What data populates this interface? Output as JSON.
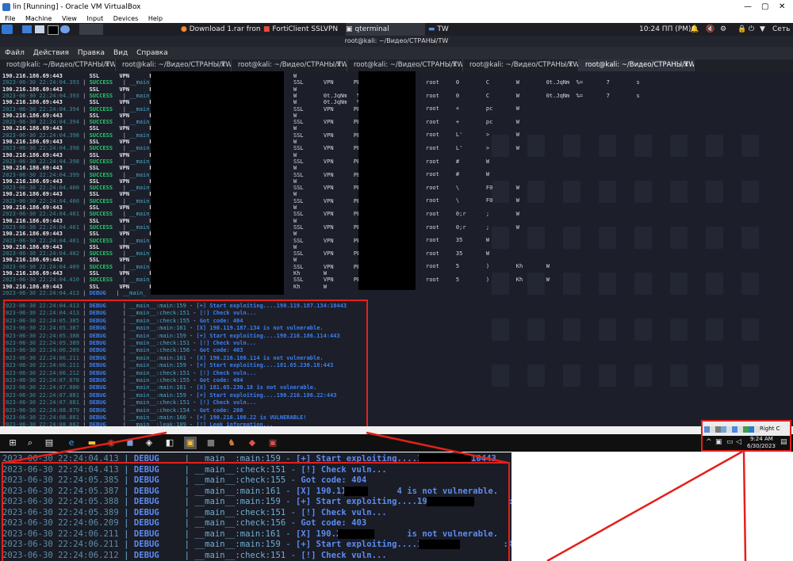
{
  "vbox": {
    "title": "lin [Running] - Oracle VM VirtualBox",
    "menu": [
      "File",
      "Machine",
      "View",
      "Input",
      "Devices",
      "Help"
    ]
  },
  "kali_panel": {
    "tasks": [
      "Download 1.rar from Se...",
      "FortiClient SSLVPN",
      "qterminal",
      "TW"
    ],
    "clock": "10:24 ПП (PM)",
    "network": "Сеть"
  },
  "terminal": {
    "title": "root@kali: ~/Видео/СТРАНЫ/TW",
    "menu": [
      "Файл",
      "Действия",
      "Правка",
      "Вид",
      "Справка"
    ],
    "tabs": [
      "root@kali: ~/Видео/СТРАНЫ/TW",
      "root@kali: ~/Видео/СТРАНЫ/TW",
      "root@kali: ~/Видео/СТРАНЫ/TW",
      "root@kali: ~/Видео/СТРАНЫ/TW",
      "root@kali: ~/Видео/СТРАНЫ/TW",
      "root@kali: ~/Видео/СТРАНЫ/TW"
    ],
    "tab_close": "×"
  },
  "left_log": [
    {
      "type": "ip",
      "text": "190.216.186.69:443        SSL      VPN      PE"
    },
    {
      "type": "succ",
      "date": "2023-06-30 22:24:04.393",
      "tag": "SUCCESS",
      "mod": "__main_"
    },
    {
      "type": "ip",
      "text": "190.216.186.69:443        SSL      VPN      PE"
    },
    {
      "type": "succ",
      "date": "2023-06-30 22:24:04.393",
      "tag": "SUCCESS",
      "mod": "__main_"
    },
    {
      "type": "ip",
      "text": "190.216.186.69:443        SSL      VPN      PE"
    },
    {
      "type": "succ",
      "date": "2023-06-30 22:24:04.394",
      "tag": "SUCCESS",
      "mod": "__main_"
    },
    {
      "type": "ip",
      "text": "190.216.186.69:443        SSL      VPN      PE"
    },
    {
      "type": "succ",
      "date": "2023-06-30 22:24:04.394",
      "tag": "SUCCESS",
      "mod": "__main_"
    },
    {
      "type": "ip",
      "text": "190.216.186.69:443        SSL      VPN      PE"
    },
    {
      "type": "succ",
      "date": "2023-06-30 22:24:04.398",
      "tag": "SUCCESS",
      "mod": "__main_"
    },
    {
      "type": "ip",
      "text": "190.216.186.69:443        SSL      VPN      PE"
    },
    {
      "type": "succ",
      "date": "2023-06-30 22:24:04.398",
      "tag": "SUCCESS",
      "mod": "__main_"
    },
    {
      "type": "ip",
      "text": "190.216.186.69:443        SSL      VPN      PE"
    },
    {
      "type": "succ",
      "date": "2023-06-30 22:24:04.398",
      "tag": "SUCCESS",
      "mod": "__main_"
    },
    {
      "type": "ip",
      "text": "190.216.186.69:443        SSL      VPN      PE"
    },
    {
      "type": "succ",
      "date": "2023-06-30 22:24:04.399",
      "tag": "SUCCESS",
      "mod": "__main_"
    },
    {
      "type": "ip",
      "text": "190.216.186.69:443        SSL      VPN      PE"
    },
    {
      "type": "succ",
      "date": "2023-06-30 22:24:04.400",
      "tag": "SUCCESS",
      "mod": "__main_"
    },
    {
      "type": "ip",
      "text": "190.216.186.69:443        SSL      VPN      PE"
    },
    {
      "type": "succ",
      "date": "2023-06-30 22:24:04.400",
      "tag": "SUCCESS",
      "mod": "__main_"
    },
    {
      "type": "ip",
      "text": "190.216.186.69:443        SSL      VPN      PE"
    },
    {
      "type": "succ",
      "date": "2023-06-30 22:24:04.401",
      "tag": "SUCCESS",
      "mod": "__main_"
    },
    {
      "type": "ip",
      "text": "190.216.186.69:443        SSL      VPN      PE"
    },
    {
      "type": "succ",
      "date": "2023-06-30 22:24:04.401",
      "tag": "SUCCESS",
      "mod": "__main_"
    },
    {
      "type": "ip",
      "text": "190.216.186.69:443        SSL      VPN      PE"
    },
    {
      "type": "succ",
      "date": "2023-06-30 22:24:04.401",
      "tag": "SUCCESS",
      "mod": "__main_"
    },
    {
      "type": "ip",
      "text": "190.216.186.69:443        SSL      VPN      PE"
    },
    {
      "type": "succ",
      "date": "2023-06-30 22:24:04.402",
      "tag": "SUCCESS",
      "mod": "__main_"
    },
    {
      "type": "ip",
      "text": "190.216.186.69:443        SSL      VPN      PE"
    },
    {
      "type": "succ",
      "date": "2023-06-30 22:24:04.409",
      "tag": "SUCCESS",
      "mod": "__main_"
    },
    {
      "type": "ip",
      "text": "190.216.186.69:443        SSL      VPN      PE"
    },
    {
      "type": "succ",
      "date": "2023-06-30 22:24:04.410",
      "tag": "SUCCESS",
      "mod": "__main_"
    },
    {
      "type": "ip",
      "text": "190.216.186.69:443        SSL      VPN      PE"
    },
    {
      "type": "succ",
      "date": "2023-06-30 22:24:04.413",
      "tag": "DEBUG",
      "mod": "__main_"
    }
  ],
  "mid_log": [
    "W",
    "SSL      VPN      PE",
    "W",
    "W        0t.JqNm   %=",
    "W        0t.JqNm   %=",
    "SSL      VPN      PE",
    "W",
    "SSL      VPN      PE",
    "W",
    "SSL      VPN      PE",
    "W",
    "SSL      VPN      PE",
    "W",
    "SSL      VPN      PE",
    "W",
    "SSL      VPN      PE",
    "W",
    "SSL      VPN      PE",
    "W",
    "SSL      VPN      PE",
    "W",
    "SSL      VPN      PE",
    "W",
    "SSL      VPN      PE",
    "W",
    "SSL      VPN      PE",
    "W",
    "SSL      VPN      PE",
    "W",
    "SSL      VPN      PE",
    "Kh       W",
    "SSL      VPN      PE",
    "Kh       W"
  ],
  "right_log": [
    "root     0        C        W        0t.JqNm  %=       7        s",
    "root     0        C        W        0t.JqNm  %=       7        s",
    "root     +        pc       W",
    "root     +        pc       W",
    "root     L'       >        W",
    "root     L'       >        W",
    "root     #        W",
    "root     #        W",
    "root     \\        F0       W",
    "root     \\        F0       W",
    "root     0;r      ;        W",
    "root     0;r      ;        W",
    "root     35       W",
    "root     35       W",
    "root     5        )        Kh       W",
    "root     5        )        Kh       W"
  ],
  "debug_log": [
    {
      "date": "2023-06-30 22:24:04.413",
      "level": "DEBUG",
      "src": "__main__:main:159",
      "msg": "[+] Start exploiting....190.119.187.134:10443"
    },
    {
      "date": "2023-06-30 22:24:04.413",
      "level": "DEBUG",
      "src": "__main__:check:151",
      "msg": "[!] Check vuln..."
    },
    {
      "date": "2023-06-30 22:24:05.385",
      "level": "DEBUG",
      "src": "__main__:check:155",
      "msg": "Got code: 404"
    },
    {
      "date": "2023-06-30 22:24:05.387",
      "level": "DEBUG",
      "src": "__main__:main:161",
      "msg": "[X] 190.119.187.134 is not vulnerable."
    },
    {
      "date": "2023-06-30 22:24:05.388",
      "level": "DEBUG",
      "src": "__main__:main:159",
      "msg": "[+] Start exploiting....190.216.186.114:443"
    },
    {
      "date": "2023-06-30 22:24:05.389",
      "level": "DEBUG",
      "src": "__main__:check:151",
      "msg": "[!] Check vuln..."
    },
    {
      "date": "2023-06-30 22:24:06.209",
      "level": "DEBUG",
      "src": "__main__:check:156",
      "msg": "Got code: 403"
    },
    {
      "date": "2023-06-30 22:24:06.211",
      "level": "DEBUG",
      "src": "__main__:main:161",
      "msg": "[X] 190.216.186.114 is not vulnerable."
    },
    {
      "date": "2023-06-30 22:24:06.211",
      "level": "DEBUG",
      "src": "__main__:main:159",
      "msg": "[+] Start exploiting....181.65.230.18:443"
    },
    {
      "date": "2023-06-30 22:24:06.212",
      "level": "DEBUG",
      "src": "__main__:check:151",
      "msg": "[!] Check vuln..."
    },
    {
      "date": "2023-06-30 22:24:07.878",
      "level": "DEBUG",
      "src": "__main__:check:155",
      "msg": "Got code: 404"
    },
    {
      "date": "2023-06-30 22:24:07.880",
      "level": "DEBUG",
      "src": "__main__:main:161",
      "msg": "[X] 181.65.230.18 is not vulnerable."
    },
    {
      "date": "2023-06-30 22:24:07.881",
      "level": "DEBUG",
      "src": "__main__:main:159",
      "msg": "[+] Start exploiting....190.216.186.22:443"
    },
    {
      "date": "2023-06-30 22:24:07.881",
      "level": "DEBUG",
      "src": "__main__:check:151",
      "msg": "[!] Check vuln..."
    },
    {
      "date": "2023-06-30 22:24:08.879",
      "level": "DEBUG",
      "src": "__main__:check:154",
      "msg": "Got code: 200"
    },
    {
      "date": "2023-06-30 22:24:08.881",
      "level": "DEBUG",
      "src": "__main__:main:160",
      "msg": "[+] 190.216.186.22 is VULNERABLE!"
    },
    {
      "date": "2023-06-30 22:24:08.882",
      "level": "DEBUG",
      "src": "__main__:leak:109",
      "msg": "[!] Leak information..."
    }
  ],
  "zoom_log": [
    {
      "date": "2023-06-30 22:24:04.413",
      "level": "DEBUG",
      "src": "__main__:main:159",
      "msg": "[+] Start exploiting....190.1"
    },
    {
      "date": "2023-06-30 22:24:04.413",
      "level": "DEBUG",
      "src": "__main__:check:151",
      "msg": "[!] Check vuln..."
    },
    {
      "date": "2023-06-30 22:24:05.385",
      "level": "DEBUG",
      "src": "__main__:check:155",
      "msg": "Got code: 404"
    },
    {
      "date": "2023-06-30 22:24:05.387",
      "level": "DEBUG",
      "src": "__main__:main:161",
      "msg": "[X] 190.119.        4 is not vulnerable."
    },
    {
      "date": "2023-06-30 22:24:05.388",
      "level": "DEBUG",
      "src": "__main__:main:159",
      "msg": "[+] Start exploiting....190.216           :443"
    },
    {
      "date": "2023-06-30 22:24:05.389",
      "level": "DEBUG",
      "src": "__main__:check:151",
      "msg": "[!] Check vuln..."
    },
    {
      "date": "2023-06-30 22:24:06.209",
      "level": "DEBUG",
      "src": "__main__:check:156",
      "msg": "Got code: 403"
    },
    {
      "date": "2023-06-30 22:24:06.211",
      "level": "DEBUG",
      "src": "__main__:main:161",
      "msg": "[X] 190.21            is not vulnerable."
    },
    {
      "date": "2023-06-30 22:24:06.211",
      "level": "DEBUG",
      "src": "__main__:main:159",
      "msg": "[+] Start exploiting....181.65           :443"
    },
    {
      "date": "2023-06-30 22:24:06.212",
      "level": "DEBUG",
      "src": "__main__:check:151",
      "msg": "[!] Check vuln..."
    }
  ],
  "zoom_tail": "10443",
  "win_tray": {
    "time": "9:24 AM",
    "date": "6/30/2023",
    "host_key": "Right C"
  },
  "colors": {
    "accent_red": "#e3201b",
    "terminal_bg": "#1c1f2a",
    "debug_blue": "#3b7ff2",
    "success_green": "#27c96a"
  }
}
